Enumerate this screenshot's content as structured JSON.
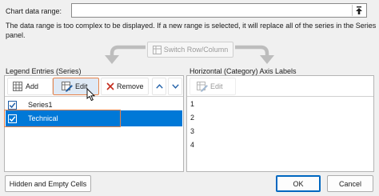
{
  "data_range": {
    "label": "Chart data range:",
    "value": "",
    "collapse_icon": "collapse-dialog-arrow-up-icon"
  },
  "message": {
    "line1": "The data range is too complex to be displayed. If a new range is selected, it will replace all of the series in the Series",
    "line2": "panel."
  },
  "switch_button": {
    "label": "Switch Row/Column",
    "icon": "switch-row-column-icon",
    "enabled": false
  },
  "legend": {
    "title": "Legend Entries (Series)",
    "add_label": "Add",
    "edit_label": "Edit",
    "remove_label": "Remove",
    "move_up_icon": "chevron-up-icon",
    "move_down_icon": "chevron-down-icon",
    "items": [
      {
        "label": "Series1",
        "checked": true,
        "selected": false
      },
      {
        "label": "Technical",
        "checked": true,
        "selected": true
      }
    ]
  },
  "axis": {
    "title": "Horizontal (Category) Axis Labels",
    "edit_label": "Edit",
    "items": [
      "1",
      "2",
      "3",
      "4"
    ]
  },
  "footer": {
    "hidden_cells_label": "Hidden and Empty Cells",
    "ok_label": "OK",
    "cancel_label": "Cancel"
  },
  "colors": {
    "accent": "#0067c0",
    "selected_row": "#0078d7",
    "highlight_outline": "#e8834a",
    "arrow_gray": "#bdbdbd"
  }
}
